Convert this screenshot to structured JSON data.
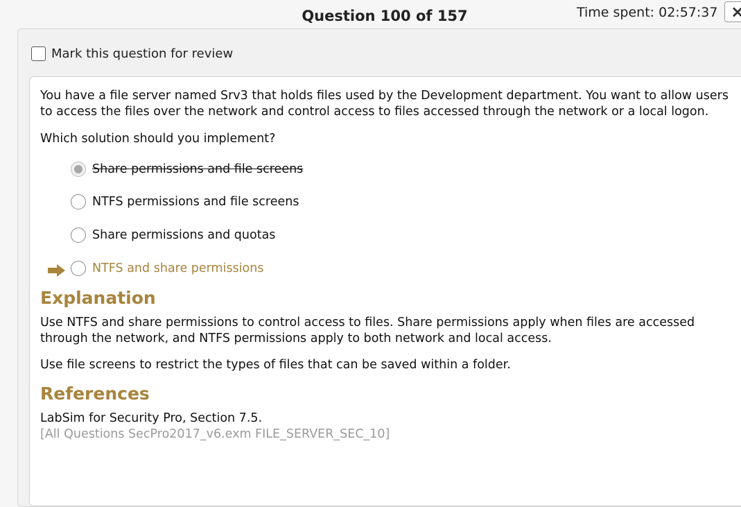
{
  "header": {
    "title": "Question 100 of 157",
    "time_spent": "Time spent: 02:57:37",
    "close_glyph": "×"
  },
  "review": {
    "label": "Mark this question for review"
  },
  "question": {
    "text": "You have a file server named Srv3 that holds files used by the Development department. You want to allow users to access the files over the network and control access to files accessed through the network or a local logon.",
    "prompt": "Which solution should you implement?",
    "options": [
      {
        "label": "Share permissions and file screens",
        "state": "selected, struck out"
      },
      {
        "label": "NTFS permissions and file screens",
        "state": "unselected"
      },
      {
        "label": "Share permissions and quotas",
        "state": "unselected"
      },
      {
        "label": "NTFS and share permissions",
        "state": "correct answer"
      }
    ],
    "correct_indicator_icon": "right-arrow-icon"
  },
  "explanation": {
    "heading": "Explanation",
    "paragraph1": "Use NTFS and share permissions to control access to files. Share permissions apply when files are accessed through the network, and NTFS permissions apply to both network and local access.",
    "paragraph2": "Use file screens to restrict the types of files that can be saved within a folder."
  },
  "references": {
    "heading": "References",
    "line1": "LabSim for Security Pro, Section 7.5.",
    "line2": "[All Questions SecPro2017_v6.exm FILE_SERVER_SEC_10]"
  },
  "colors": {
    "accent": "#a8843c",
    "muted": "#9a9a9a"
  }
}
